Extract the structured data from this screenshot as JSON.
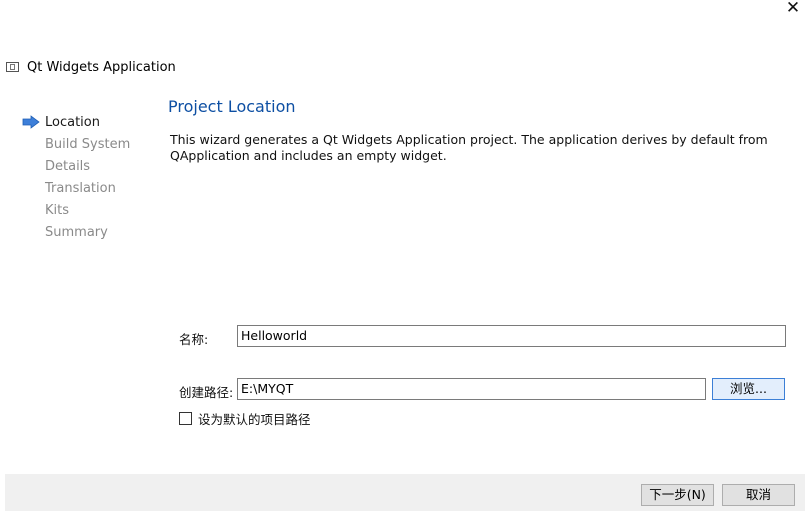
{
  "window": {
    "title": "Qt Widgets Application",
    "close_glyph": "✕"
  },
  "steps": [
    {
      "label": "Location",
      "active": true
    },
    {
      "label": "Build System",
      "active": false
    },
    {
      "label": "Details",
      "active": false
    },
    {
      "label": "Translation",
      "active": false
    },
    {
      "label": "Kits",
      "active": false
    },
    {
      "label": "Summary",
      "active": false
    }
  ],
  "page": {
    "title": "Project Location",
    "description": "This wizard generates a Qt Widgets Application project. The application derives by default from QApplication and includes an empty widget."
  },
  "form": {
    "name_label": "名称:",
    "name_value": "Helloworld",
    "path_label": "创建路径:",
    "path_value": "E:\\MYQT",
    "browse_label": "浏览...",
    "default_path_label": "设为默认的项目路径",
    "default_path_checked": false
  },
  "footer": {
    "next_label": "下一步(N)",
    "cancel_label": "取消"
  },
  "colors": {
    "accent": "#0d4fa3",
    "step_arrow": "#3d7fd9",
    "inactive_step": "#8a8a8a"
  },
  "icons": {
    "app": "qt-app-icon",
    "current_step": "arrow-right-icon",
    "close": "close-icon"
  }
}
